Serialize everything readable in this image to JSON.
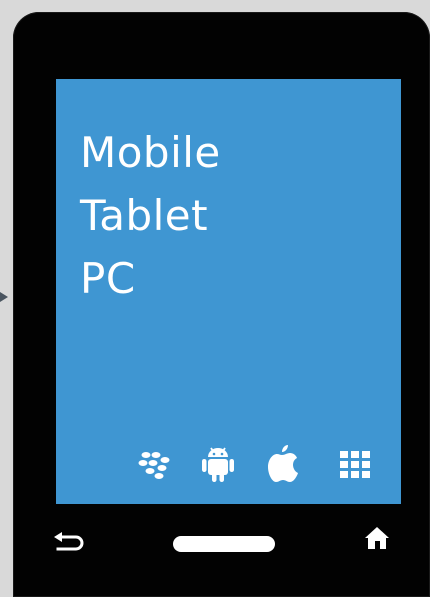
{
  "screen": {
    "lines": [
      "Mobile",
      "Tablet",
      "PC"
    ]
  },
  "platform_icons": [
    "blackberry-icon",
    "android-icon",
    "apple-icon",
    "windows-grid-icon"
  ],
  "navigation": [
    "back-icon",
    "home-pill",
    "home-icon"
  ],
  "colors": {
    "screen_background": "#3f96d2",
    "device_body": "#020202",
    "page_background": "#d9d9d9",
    "text": "#ffffff"
  }
}
